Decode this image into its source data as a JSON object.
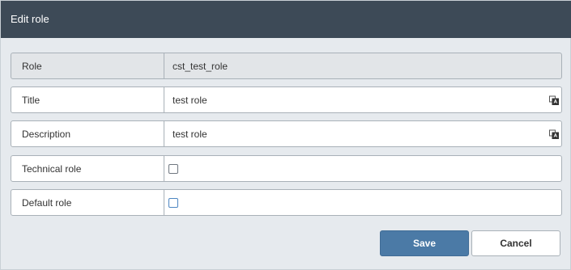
{
  "dialog": {
    "title": "Edit role"
  },
  "fields": {
    "role": {
      "label": "Role",
      "value": "cst_test_role"
    },
    "title": {
      "label": "Title",
      "value": "test role"
    },
    "description": {
      "label": "Description",
      "value": "test role"
    },
    "technical_role": {
      "label": "Technical role",
      "checked": false
    },
    "default_role": {
      "label": "Default role",
      "checked": false
    }
  },
  "buttons": {
    "save_label": "Save",
    "cancel_label": "Cancel"
  },
  "colors": {
    "titlebar_bg": "#3d4a57",
    "dialog_bg": "#e6eaee",
    "save_bg": "#4b7aa6"
  },
  "icons": {
    "field_action": "translate-icon"
  }
}
